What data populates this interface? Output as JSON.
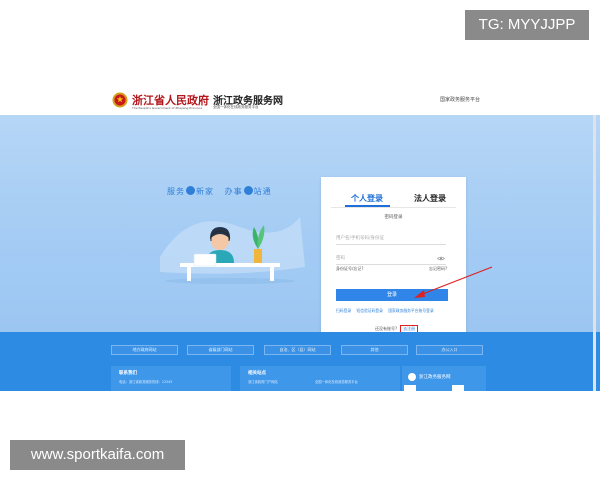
{
  "badges": {
    "tg": "TG: MYYJJPP",
    "watermark": "www.sportkaifa.com"
  },
  "header": {
    "logo_main": "浙江省人民政府",
    "logo_main_sub": "The People's Government of Zhejiang Province",
    "logo_service": "浙江政务服务网",
    "logo_service_sub": "全国一体化在线政务服务平台",
    "right_link": "国家政务服务平台"
  },
  "hero": {
    "slogan_part1": "服务",
    "slogan_part2": "新家",
    "slogan_part3": "办事",
    "slogan_part4": "站通"
  },
  "login": {
    "tab_personal": "个人登录",
    "tab_legal": "法人登录",
    "mode_label": "密码登录",
    "username_placeholder": "用户名/手机号码/身份证",
    "password_placeholder": "密码",
    "forgot_username": "身份证号/忘记?",
    "forgot_password": "忘记密码?",
    "login_button": "登录",
    "other_link_1": "扫码登录",
    "other_link_2": "短信验证码登录",
    "other_link_3": "国家政务服务平台账号登录",
    "register_prompt": "还没有账号?",
    "register_link": "去注册"
  },
  "footer": {
    "buttons": [
      "地方政府网站",
      "省级部门网站",
      "自治、区（县）网站",
      "其他",
      "办公入口"
    ],
    "panel1_title": "联系我们",
    "panel1_text": "电话：浙江省政务服务热线：12345",
    "panel2_title": "相关站点",
    "panel2_text_1": "浙江省政府门户网站",
    "panel2_text_2": "全国一体化在线政务服务平台",
    "panel3_logo_text": "浙江政务服务网"
  },
  "colors": {
    "accent": "#1e6fd9",
    "hero_bg": "#a3cbf4",
    "footer_bg": "#2e8be4",
    "alert_red": "#e02020"
  }
}
